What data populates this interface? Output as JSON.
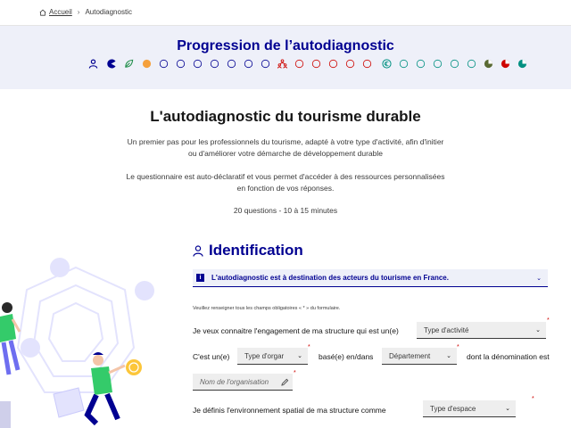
{
  "breadcrumb": {
    "home": "Accueil",
    "current": "Autodiagnostic"
  },
  "progress": {
    "title": "Progression de l’autodiagnostic",
    "colors": {
      "primary": "#000091",
      "orange": "#f5a03c",
      "green": "#1f8d49",
      "red": "#ce0500",
      "teal": "#009081",
      "olive": "#5a6a34"
    }
  },
  "intro": {
    "title": "L'autodiagnostic du tourisme durable",
    "p1": "Un premier pas pour les professionnels du tourisme, adapté à votre type d'activité, afin d'initier ou d'améliorer votre démarche de développement durable",
    "p2": "Le questionnaire est auto-déclaratif et vous permet d'accéder à des ressources personnalisées en fonction de vos réponses.",
    "p3": "20 questions - 10 à 15 minutes"
  },
  "identification": {
    "title": "Identification",
    "accordion_label": "L'autodiagnostic est à destination des acteurs du tourisme en France.",
    "hint": "Veuillez renseigner tous les champs obligatoires « * » du formulaire.",
    "q1_text": "Je veux connaitre l'engagement de ma structure qui est un(e)",
    "q1_select": "Type d'activité",
    "q2_prefix": "C'est un(e)",
    "q2_select1": "Type d'orgar",
    "q2_middle": "basé(e) en/dans",
    "q2_select2": "Département",
    "q2_suffix": "dont la dénomination est",
    "q2_input": "Nom de l'organisation",
    "q3_text": "Je définis l'environnement spatial de ma structure comme",
    "q3_select": "Type d'espace",
    "required": "*"
  }
}
